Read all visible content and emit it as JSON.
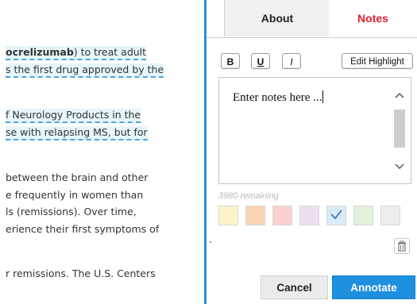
{
  "document": {
    "lines": [
      {
        "pre": "",
        "bold": "ocrelizumab",
        "post": ") to treat adult"
      },
      {
        "pre": "",
        "bold": "",
        "post": "s the first drug approved by the"
      },
      {
        "pre": "",
        "bold": "",
        "post": "f Neurology Products in the"
      },
      {
        "pre": "",
        "bold": "",
        "post": "se with relapsing MS, but for"
      },
      {
        "pre": "",
        "bold": "",
        "post": "between the brain and other"
      },
      {
        "pre": "",
        "bold": "",
        "post": "e frequently in women than"
      },
      {
        "pre": "",
        "bold": "",
        "post": "ls (remissions). Over time,"
      },
      {
        "pre": "",
        "bold": "",
        "post": "erience their first symptoms of"
      },
      {
        "pre": "",
        "bold": "",
        "post": "r remissions. The U.S. Centers"
      }
    ]
  },
  "tabs": {
    "about": "About",
    "notes": "Notes"
  },
  "toolbar": {
    "bold_label": "B",
    "underline_label": "U",
    "italic_label": "I",
    "edit_highlight_label": "Edit Highlight"
  },
  "editor": {
    "placeholder": "Enter notes here ..."
  },
  "remaining_text": "3980 remaining",
  "swatches": [
    {
      "color": "#fdf3c9",
      "selected": false
    },
    {
      "color": "#f8d4b0",
      "selected": false
    },
    {
      "color": "#f8d0d0",
      "selected": false
    },
    {
      "color": "#ebe1ee",
      "selected": false
    },
    {
      "color": "#d9ebf6",
      "selected": true
    },
    {
      "color": "#e3f1dd",
      "selected": false
    },
    {
      "color": "#eeeeee",
      "selected": false
    }
  ],
  "actions": {
    "cancel_label": "Cancel",
    "annotate_label": "Annotate"
  },
  "colors": {
    "accent": "#1f8fe0",
    "notes_tab": "#e0222d",
    "divider": "#2b8fd6"
  }
}
